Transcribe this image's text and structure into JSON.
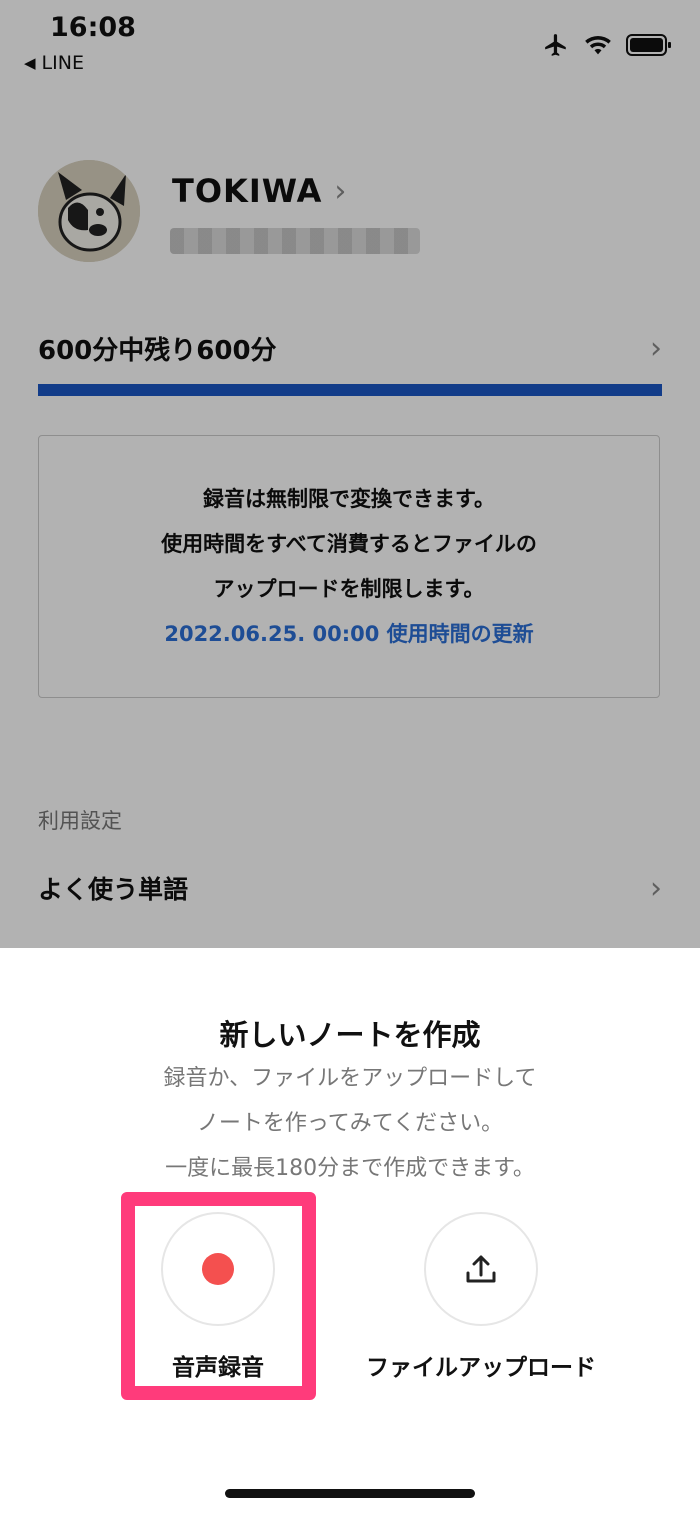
{
  "status": {
    "time": "16:08",
    "back_app": "LINE"
  },
  "profile": {
    "name": "TOKIWA"
  },
  "usage": {
    "text": "600分中残り600分",
    "remaining_fraction": 1.0,
    "bar_color": "#1a56c4"
  },
  "info": {
    "line1": "録音は無制限で変換できます。",
    "line2": "使用時間をすべて消費するとファイルの",
    "line3": "アップロードを制限します。",
    "renewal": "2022.06.25. 00:00 使用時間の更新"
  },
  "settings": {
    "section_label": "利用設定",
    "frequent_words": "よく使う単語"
  },
  "sheet": {
    "title": "新しいノートを作成",
    "desc1": "録音か、ファイルをアップロードして",
    "desc2": "ノートを作ってみてください。",
    "desc3": "一度に最長180分まで作成できます。",
    "record_label": "音声録音",
    "upload_label": "ファイルアップロード"
  }
}
